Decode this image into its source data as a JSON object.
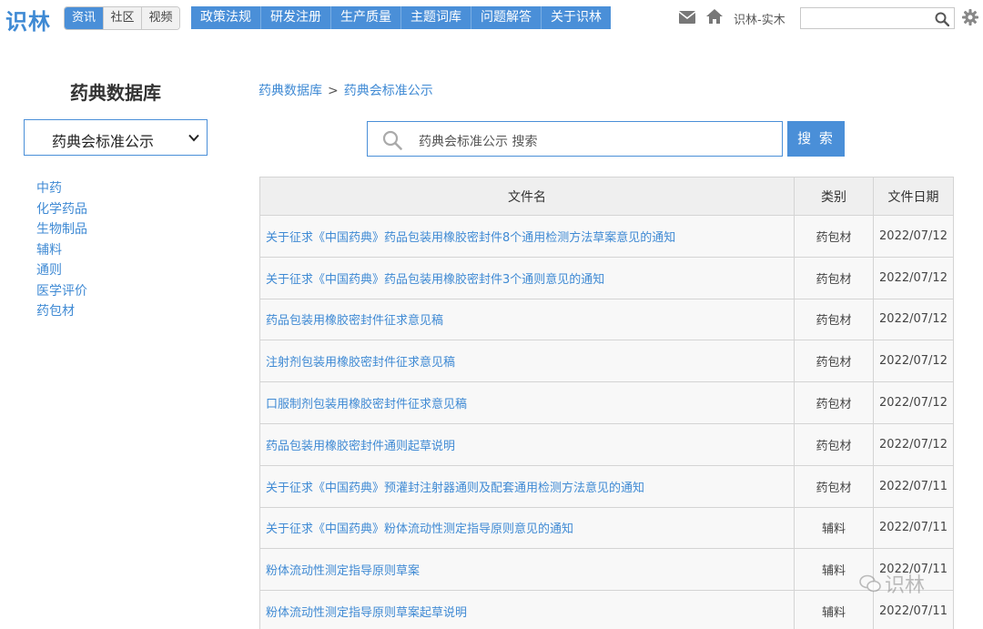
{
  "header": {
    "logo": "识林",
    "segments": [
      {
        "label": "资讯",
        "active": true
      },
      {
        "label": "社区",
        "active": false
      },
      {
        "label": "视频",
        "active": false
      }
    ],
    "nav": [
      "政策法规",
      "研发注册",
      "生产质量",
      "主题词库",
      "问题解答",
      "关于识林"
    ],
    "icons": [
      "mail-icon",
      "home-icon"
    ],
    "user": "识林-实木",
    "search_placeholder": "",
    "accent_color": "#4a8fd8"
  },
  "sidebar": {
    "title": "药典数据库",
    "select_value": "药典会标准公示",
    "items": [
      "中药",
      "化学药品",
      "生物制品",
      "辅料",
      "通则",
      "医学评价",
      "药包材"
    ]
  },
  "main": {
    "breadcrumb": [
      "药典数据库",
      "药典会标准公示"
    ],
    "breadcrumb_sep": ">",
    "search_placeholder": "药典会标准公示 搜索",
    "search_button": "搜 索",
    "table": {
      "headers": [
        "文件名",
        "类别",
        "文件日期"
      ],
      "rows": [
        [
          "关于征求《中国药典》药品包装用橡胶密封件8个通用检测方法草案意见的通知",
          "药包材",
          "2022/07/12"
        ],
        [
          "关于征求《中国药典》药品包装用橡胶密封件3个通则意见的通知",
          "药包材",
          "2022/07/12"
        ],
        [
          "药品包装用橡胶密封件征求意见稿",
          "药包材",
          "2022/07/12"
        ],
        [
          "注射剂包装用橡胶密封件征求意见稿",
          "药包材",
          "2022/07/12"
        ],
        [
          "口服制剂包装用橡胶密封件征求意见稿",
          "药包材",
          "2022/07/12"
        ],
        [
          "药品包装用橡胶密封件通则起草说明",
          "药包材",
          "2022/07/12"
        ],
        [
          "关于征求《中国药典》预灌封注射器通则及配套通用检测方法意见的通知",
          "药包材",
          "2022/07/11"
        ],
        [
          "关于征求《中国药典》粉体流动性测定指导原则意见的通知",
          "辅料",
          "2022/07/11"
        ],
        [
          "粉体流动性测定指导原则草案",
          "辅料",
          "2022/07/11"
        ],
        [
          "粉体流动性测定指导原则草案起草说明",
          "辅料",
          "2022/07/11"
        ]
      ]
    }
  },
  "watermark": "识林"
}
